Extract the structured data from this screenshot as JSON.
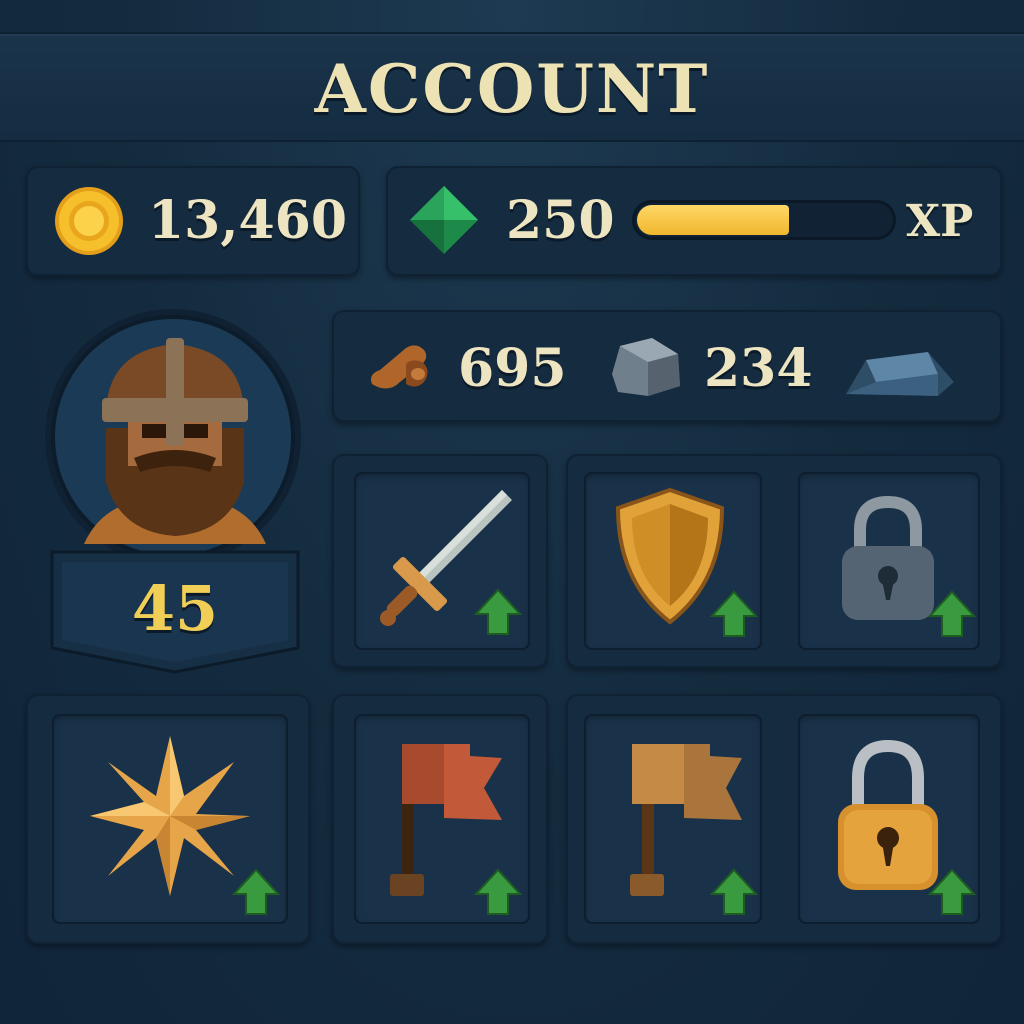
{
  "header": {
    "title": "ACCOUNT"
  },
  "currency": {
    "gold": {
      "value": "13,460",
      "icon": "gold-coin-icon"
    },
    "gems": {
      "value": "250",
      "icon": "emerald-gem-icon"
    },
    "xp": {
      "label": "XP",
      "progress": 0.6
    }
  },
  "resources": [
    {
      "icon": "wood-log-icon",
      "value": "695"
    },
    {
      "icon": "stone-icon",
      "value": "234"
    },
    {
      "icon": "iron-ingot-icon",
      "value": ""
    }
  ],
  "player": {
    "avatar": "viking-warrior-avatar",
    "level": "45"
  },
  "upgrades": [
    {
      "icon": "sword-icon",
      "state": "upgradable"
    },
    {
      "icon": "shield-icon",
      "state": "upgradable"
    },
    {
      "icon": "padlock-gray-icon",
      "state": "locked-upgradable"
    },
    {
      "icon": "compass-star-icon",
      "state": "upgradable"
    },
    {
      "icon": "red-flag-icon",
      "state": "upgradable"
    },
    {
      "icon": "brown-flag-icon",
      "state": "upgradable"
    },
    {
      "icon": "padlock-gold-icon",
      "state": "locked-upgradable"
    }
  ],
  "colors": {
    "background": "#142b3e",
    "title": "#ece2b4",
    "level": "#f1cf57",
    "xp_fill": "#f0b72e",
    "upgrade_arrow": "#3a9a3f"
  }
}
